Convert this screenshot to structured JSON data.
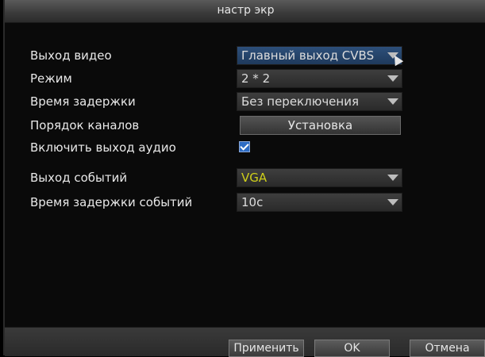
{
  "window": {
    "title": "настр экр"
  },
  "settings": [
    {
      "label": "Выход видео",
      "type": "select",
      "value": "Главный выход CVBS",
      "selected": true
    },
    {
      "label": "Режим",
      "type": "select",
      "value": "2 * 2"
    },
    {
      "label": "Время задержки",
      "type": "select",
      "value": "Без переключения"
    },
    {
      "label": "Порядок каналов",
      "type": "button",
      "button_label": "Установка"
    },
    {
      "label": "Включить выход аудио",
      "type": "checkbox",
      "checked": true
    },
    {
      "label": "Выход событий",
      "type": "select",
      "value": "VGA"
    },
    {
      "label": "Время задержки событий",
      "type": "select",
      "value": "10с"
    }
  ],
  "footer": {
    "apply_label": "Применить",
    "ok_label": "OK",
    "cancel_label": "Отмена"
  },
  "colors": {
    "selected_field": "#2d4f7a",
    "checkbox": "#2d6cc4",
    "vga_text": "#cfcf1a"
  }
}
